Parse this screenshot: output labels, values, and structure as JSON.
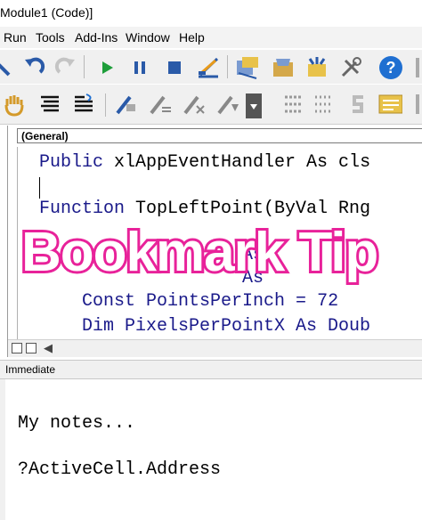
{
  "window": {
    "title": "Module1 (Code)]"
  },
  "menu": {
    "items": [
      "Run",
      "Tools",
      "Add-Ins",
      "Window",
      "Help"
    ]
  },
  "code": {
    "object_selector": "(General)",
    "lines": [
      {
        "keyword": "Public",
        "rest": " xlAppEventHandler As cls"
      },
      {
        "keyword": "",
        "rest": ""
      },
      {
        "keyword": "Function",
        "rest": " TopLeftPoint(ByVal Rng"
      },
      {
        "keyword": "",
        "rest": "                   As"
      },
      {
        "keyword": "",
        "rest": "                   As"
      },
      {
        "keyword": "    Const",
        "rest": " PointsPerInch = 72"
      },
      {
        "keyword": "    Dim",
        "rest": " PixelsPerPointX As Doub"
      }
    ]
  },
  "immediate": {
    "title": "Immediate",
    "lines": [
      "My notes...",
      "?ActiveCell.Address"
    ]
  },
  "overlay": {
    "text": "Bookmark Tip",
    "stroke_color": "#e8229a",
    "fill_color": "#ffffff"
  },
  "colors": {
    "keyword": "#1a1a8a",
    "run_green": "#1e9e3a",
    "help_blue": "#1f6fd1"
  }
}
